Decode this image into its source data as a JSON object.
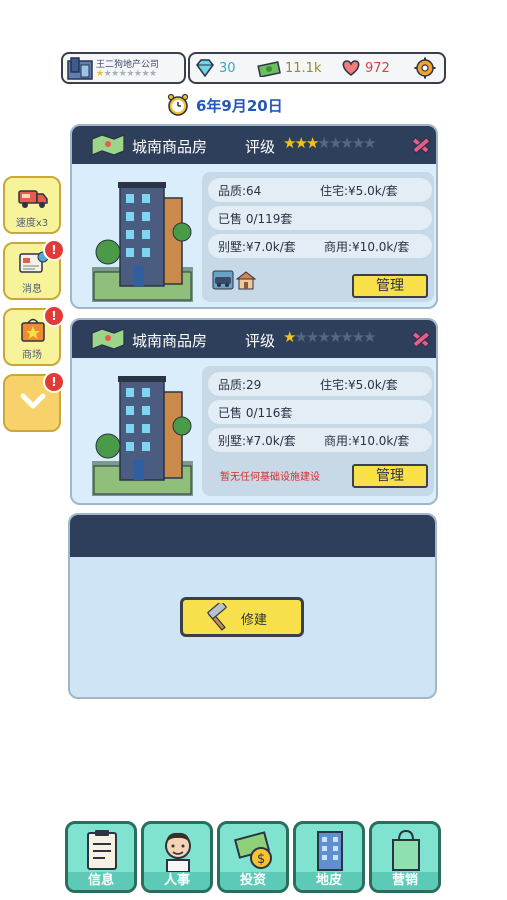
{
  "company": {
    "name": "王二狗地产公司",
    "stars_filled": 1,
    "stars_total": 8
  },
  "resources": {
    "diamonds": "30",
    "cash": "11.1k",
    "hearts": "972"
  },
  "date": "6年9月20日",
  "side_buttons": [
    {
      "label": "速度x3",
      "icon": "truck-icon",
      "badge": ""
    },
    {
      "label": "消息",
      "icon": "message-icon",
      "badge": "!"
    },
    {
      "label": "商场",
      "icon": "mall-icon",
      "badge": "!"
    },
    {
      "label": "",
      "icon": "chevron-down-icon",
      "badge": "!"
    }
  ],
  "properties": [
    {
      "title": "城南商品房",
      "rating_label": "评级",
      "stars_filled": 3,
      "stars_total": 8,
      "quality": "品质:64",
      "residential": "住宅:¥5.0k/套",
      "sold": "已售 0/119套",
      "villa": "别墅:¥7.0k/套",
      "commercial": "商用:¥10.0k/套",
      "facilities": [
        "car-icon",
        "house-icon"
      ],
      "warning": "",
      "manage_label": "管理"
    },
    {
      "title": "城南商品房",
      "rating_label": "评级",
      "stars_filled": 1,
      "stars_total": 8,
      "quality": "品质:29",
      "residential": "住宅:¥5.0k/套",
      "sold": "已售 0/116套",
      "villa": "别墅:¥7.0k/套",
      "commercial": "商用:¥10.0k/套",
      "facilities": [],
      "warning": "暂无任何基础设施建设",
      "manage_label": "管理"
    }
  ],
  "build_slot": {
    "label": "修建",
    "icon": "hammer-icon"
  },
  "bottom_nav": [
    {
      "label": "信息",
      "icon": "clipboard-icon"
    },
    {
      "label": "人事",
      "icon": "person-icon"
    },
    {
      "label": "投资",
      "icon": "money-icon"
    },
    {
      "label": "地皮",
      "icon": "land-icon"
    },
    {
      "label": "营销",
      "icon": "shopping-bag-icon"
    }
  ],
  "colors": {
    "header": "#2e3f5c",
    "card_bg": "#d9eefa",
    "button_yellow": "#f8e04a",
    "nav_green": "#7fe3cf",
    "date_blue": "#2557b8",
    "star": "#f2c21b",
    "warning_red": "#d02f2f"
  }
}
